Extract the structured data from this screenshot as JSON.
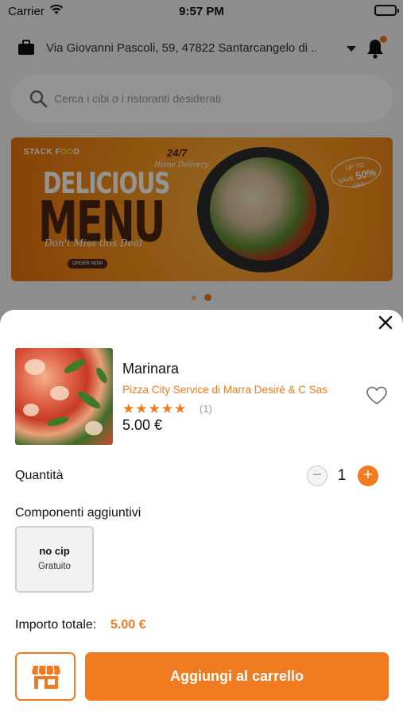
{
  "statusbar": {
    "carrier": "Carrier",
    "time": "9:57 PM"
  },
  "header": {
    "address": "Via Giovanni Pascoli, 59, 47822 Santarcangelo di ..."
  },
  "search": {
    "placeholder": "Cerca i cibi o i ristoranti desiderati"
  },
  "banner": {
    "brand_prefix": "STACK F",
    "brand_suffix": "D",
    "line1": "DELICIOUS",
    "line2": "MENU",
    "tagline": "Don't Miss this Deal",
    "order_now": "ORDER NOW",
    "badge_247": "24/7",
    "home_delivery": "Home Delivery",
    "save_text": "SAVE",
    "up_to": "UP TO",
    "discount": "50%",
    "off": "OFF"
  },
  "carousel": {
    "total": 2,
    "active": 2
  },
  "product": {
    "name": "Marinara",
    "restaurant": "Pizza City Service di Marra Desiré & C Sas",
    "stars": "★★★★★",
    "rating_count": "(1)",
    "price": "5.00 €"
  },
  "quantity": {
    "label": "Quantità",
    "value": "1",
    "minus": "−",
    "plus": "+"
  },
  "addons": {
    "label": "Componenti aggiuntivi",
    "items": [
      {
        "name": "no cip",
        "price": "Gratuito"
      }
    ]
  },
  "total": {
    "label": "Importo totale:",
    "value": "5.00 €"
  },
  "actions": {
    "add_to_cart": "Aggiungi al carrello"
  },
  "colors": {
    "accent": "#f07b20",
    "text": "#111111",
    "muted": "#9a9a9a"
  },
  "icons": [
    "wifi-icon",
    "battery-icon",
    "briefcase-icon",
    "caret-down-icon",
    "bell-icon",
    "search-icon",
    "close-icon",
    "heart-icon",
    "store-icon"
  ]
}
